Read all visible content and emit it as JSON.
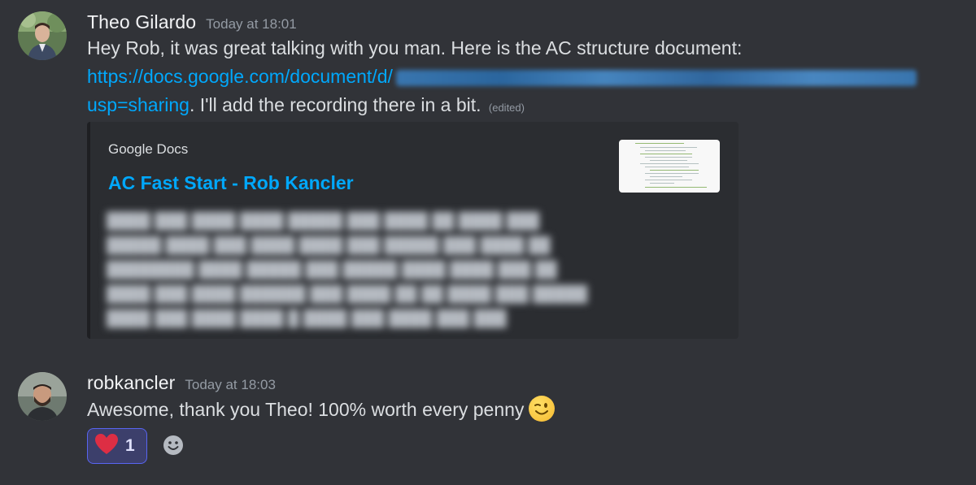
{
  "messages": [
    {
      "username": "Theo Gilardo",
      "timestamp": "Today at 18:01",
      "line1": "Hey Rob, it was great talking with you man. Here is the AC structure document:",
      "link_start": "https://docs.google.com/document/d/",
      "link_end": "usp=sharing",
      "line2_rest": ". I'll add the recording there in a bit.",
      "edited": "(edited)",
      "embed": {
        "provider": "Google Docs",
        "title": "AC Fast Start - Rob Kancler"
      }
    },
    {
      "username": "robkancler",
      "timestamp": "Today at 18:03",
      "text": "Awesome, thank you Theo! 100% worth every penny",
      "emoji": "wink-emoji",
      "reactions": [
        {
          "emoji": "heart-icon",
          "count": "1"
        }
      ]
    }
  ],
  "colors": {
    "background": "#313338",
    "link": "#00a8fc",
    "embed_bg": "#2b2d31",
    "reaction_bg": "#3c3f6b",
    "reaction_border": "#5865f2"
  }
}
